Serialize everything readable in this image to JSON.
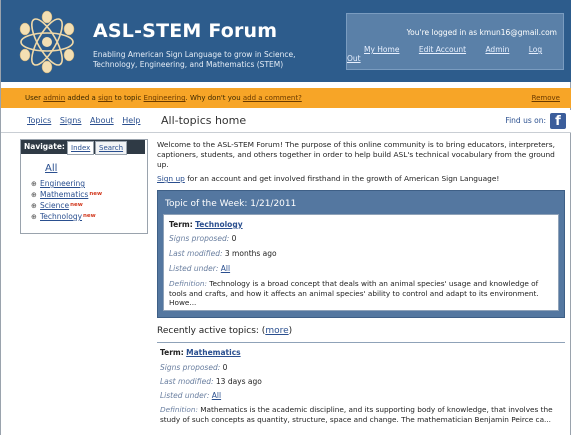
{
  "header": {
    "title": "ASL-STEM Forum",
    "tagline": "Enabling American Sign Language to grow in Science, Technology, Engineering, and Mathematics (STEM)",
    "logged_in_text": "You're logged in as kmun16@gmail.com",
    "links": [
      "My Home",
      "Edit Account",
      "Admin",
      "Log Out"
    ],
    "brand_color": "#2d5c8c"
  },
  "notice": {
    "prefix": "User",
    "user_link": "admin",
    "mid1": "added a",
    "sign_link": "sign",
    "mid2": "to topic",
    "topic_link": "Engineering",
    "question": ". Why don't you",
    "comment_link": "add a comment?",
    "remove": "Remove",
    "color": "#f7a527"
  },
  "topnav": {
    "links": [
      "Topics",
      "Signs",
      "About",
      "Help"
    ],
    "breadcrumb": "All-topics home",
    "find_us": "Find us on:",
    "fb_icon": "f"
  },
  "navbox": {
    "label": "Navigate:",
    "tabs": [
      "Index",
      "Search"
    ],
    "all": "All",
    "items": [
      {
        "label": "Engineering",
        "new": ""
      },
      {
        "label": "Mathematics",
        "new": "new"
      },
      {
        "label": "Science",
        "new": "new"
      },
      {
        "label": "Technology",
        "new": "new"
      }
    ]
  },
  "intro": {
    "welcome": "Welcome to the ASL-STEM Forum! The purpose of this online community is to bring educators, interpreters, captioners, students, and others together in order to help build ASL's technical vocabulary from the ground up.",
    "signup_link": "Sign up",
    "signup_rest": " for an account and get involved firsthand in the growth of American Sign Language!"
  },
  "topic_of_week": {
    "title": "Topic of the Week: 1/21/2011",
    "term_label": "Term:",
    "term": "Technology",
    "signs_label": "Signs proposed:",
    "signs": "0",
    "modified_label": "Last modified:",
    "modified": "3 months ago",
    "listed_label": "Listed under:",
    "listed": "All",
    "def_label": "Definition:",
    "definition": "Technology is a broad concept that deals with an animal species' usage and knowledge of tools and crafts, and how it affects an animal species' ability to control and adapt to its environment. Howe..."
  },
  "recent": {
    "heading": "Recently active topics: (",
    "more": "more",
    "close": ")",
    "term_label": "Term:",
    "term": "Mathematics",
    "signs_label": "Signs proposed:",
    "signs": "0",
    "modified_label": "Last modified:",
    "modified": "13 days ago",
    "listed_label": "Listed under:",
    "listed": "All",
    "def_label": "Definition:",
    "definition": "Mathematics is the academic discipline, and its supporting body of knowledge, that involves the study of such concepts as quantity, structure, space and change. The mathematician Benjamin Peirce ca..."
  }
}
